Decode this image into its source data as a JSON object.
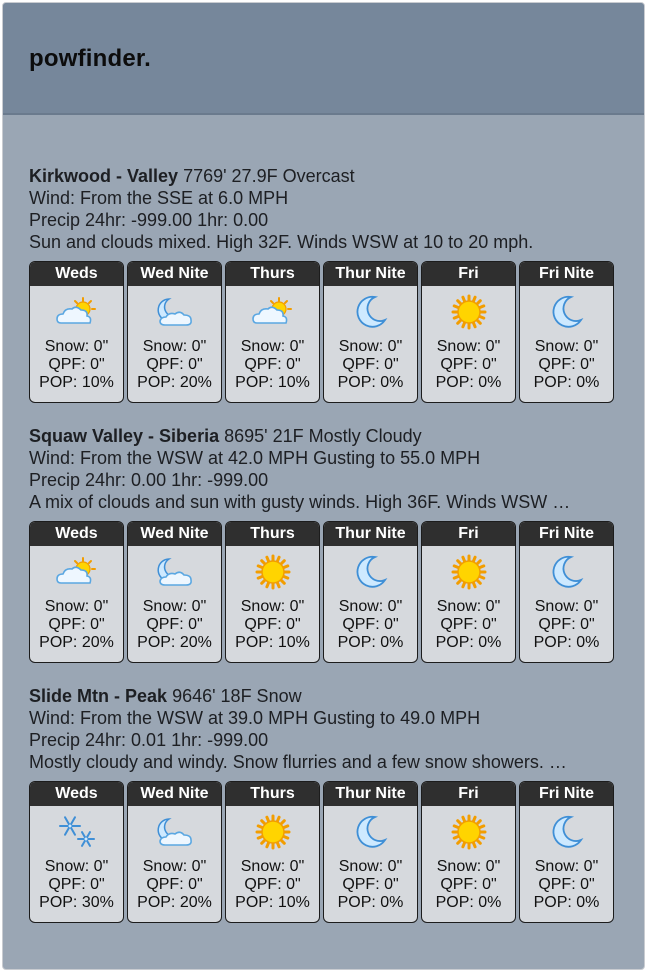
{
  "app": {
    "title": "powfinder."
  },
  "resorts": [
    {
      "name": "Kirkwood - Valley",
      "info": "7769' 27.9F Overcast",
      "wind": "Wind: From the SSE at 6.0 MPH",
      "precip": "Precip 24hr: -999.00 1hr: 0.00",
      "summary": "Sun and clouds mixed. High 32F. Winds WSW at 10 to 20 mph.",
      "forecast": [
        {
          "day": "Weds",
          "icon": "partly-cloudy-icon",
          "snow": "Snow: 0\"",
          "qpf": "QPF: 0\"",
          "pop": "POP: 10%"
        },
        {
          "day": "Wed Nite",
          "icon": "partly-cloudy-night-icon",
          "snow": "Snow: 0\"",
          "qpf": "QPF: 0\"",
          "pop": "POP: 20%"
        },
        {
          "day": "Thurs",
          "icon": "partly-cloudy-icon",
          "snow": "Snow: 0\"",
          "qpf": "QPF: 0\"",
          "pop": "POP: 10%"
        },
        {
          "day": "Thur Nite",
          "icon": "moon-icon",
          "snow": "Snow: 0\"",
          "qpf": "QPF: 0\"",
          "pop": "POP: 0%"
        },
        {
          "day": "Fri",
          "icon": "sun-icon",
          "snow": "Snow: 0\"",
          "qpf": "QPF: 0\"",
          "pop": "POP: 0%"
        },
        {
          "day": "Fri Nite",
          "icon": "moon-icon",
          "snow": "Snow: 0\"",
          "qpf": "QPF: 0\"",
          "pop": "POP: 0%"
        }
      ]
    },
    {
      "name": "Squaw Valley - Siberia",
      "info": "8695' 21F Mostly Cloudy",
      "wind": "Wind: From the WSW at 42.0 MPH Gusting to 55.0 MPH",
      "precip": "Precip 24hr: 0.00 1hr: -999.00",
      "summary": "A mix of clouds and sun with gusty winds. High 36F. Winds WSW …",
      "forecast": [
        {
          "day": "Weds",
          "icon": "partly-cloudy-icon",
          "snow": "Snow: 0\"",
          "qpf": "QPF: 0\"",
          "pop": "POP: 20%"
        },
        {
          "day": "Wed Nite",
          "icon": "partly-cloudy-night-icon",
          "snow": "Snow: 0\"",
          "qpf": "QPF: 0\"",
          "pop": "POP: 20%"
        },
        {
          "day": "Thurs",
          "icon": "sun-icon",
          "snow": "Snow: 0\"",
          "qpf": "QPF: 0\"",
          "pop": "POP: 10%"
        },
        {
          "day": "Thur Nite",
          "icon": "moon-icon",
          "snow": "Snow: 0\"",
          "qpf": "QPF: 0\"",
          "pop": "POP: 0%"
        },
        {
          "day": "Fri",
          "icon": "sun-icon",
          "snow": "Snow: 0\"",
          "qpf": "QPF: 0\"",
          "pop": "POP: 0%"
        },
        {
          "day": "Fri Nite",
          "icon": "moon-icon",
          "snow": "Snow: 0\"",
          "qpf": "QPF: 0\"",
          "pop": "POP: 0%"
        }
      ]
    },
    {
      "name": "Slide Mtn - Peak",
      "info": "9646' 18F Snow",
      "wind": "Wind: From the WSW at 39.0 MPH Gusting to 49.0 MPH",
      "precip": "Precip 24hr: 0.01 1hr: -999.00",
      "summary": "Mostly cloudy and windy. Snow flurries and a few snow showers. …",
      "forecast": [
        {
          "day": "Weds",
          "icon": "snowflakes-icon",
          "snow": "Snow: 0\"",
          "qpf": "QPF: 0\"",
          "pop": "POP: 30%"
        },
        {
          "day": "Wed Nite",
          "icon": "partly-cloudy-night-icon",
          "snow": "Snow: 0\"",
          "qpf": "QPF: 0\"",
          "pop": "POP: 20%"
        },
        {
          "day": "Thurs",
          "icon": "sun-icon",
          "snow": "Snow: 0\"",
          "qpf": "QPF: 0\"",
          "pop": "POP: 10%"
        },
        {
          "day": "Thur Nite",
          "icon": "moon-icon",
          "snow": "Snow: 0\"",
          "qpf": "QPF: 0\"",
          "pop": "POP: 0%"
        },
        {
          "day": "Fri",
          "icon": "sun-icon",
          "snow": "Snow: 0\"",
          "qpf": "QPF: 0\"",
          "pop": "POP: 0%"
        },
        {
          "day": "Fri Nite",
          "icon": "moon-icon",
          "snow": "Snow: 0\"",
          "qpf": "QPF: 0\"",
          "pop": "POP: 0%"
        }
      ]
    }
  ]
}
